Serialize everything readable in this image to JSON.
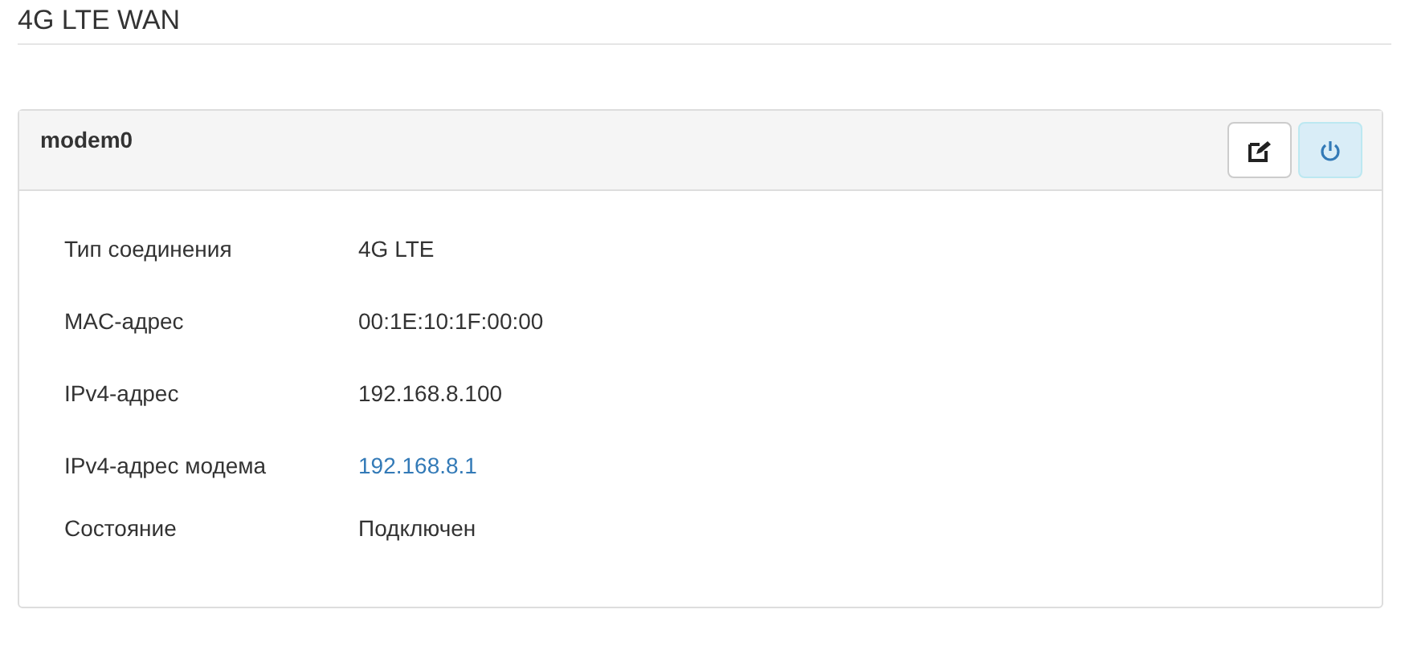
{
  "page": {
    "title": "4G LTE WAN"
  },
  "panel": {
    "title": "modem0",
    "buttons": [
      {
        "kind": "edit",
        "active": false
      },
      {
        "kind": "power",
        "active": true
      }
    ],
    "rows": [
      {
        "label": "Тип соединения",
        "value": "4G LTE",
        "kind": "text"
      },
      {
        "label": "MAC-адрес",
        "value": "00:1E:10:1F:00:00",
        "kind": "text"
      },
      {
        "label": "IPv4-адрес",
        "value": "192.168.8.100",
        "kind": "text"
      },
      {
        "label": "IPv4-адрес модема",
        "value": "192.168.8.1",
        "kind": "link"
      },
      {
        "label": "Состояние",
        "value": "Подключен",
        "kind": "text"
      }
    ]
  }
}
